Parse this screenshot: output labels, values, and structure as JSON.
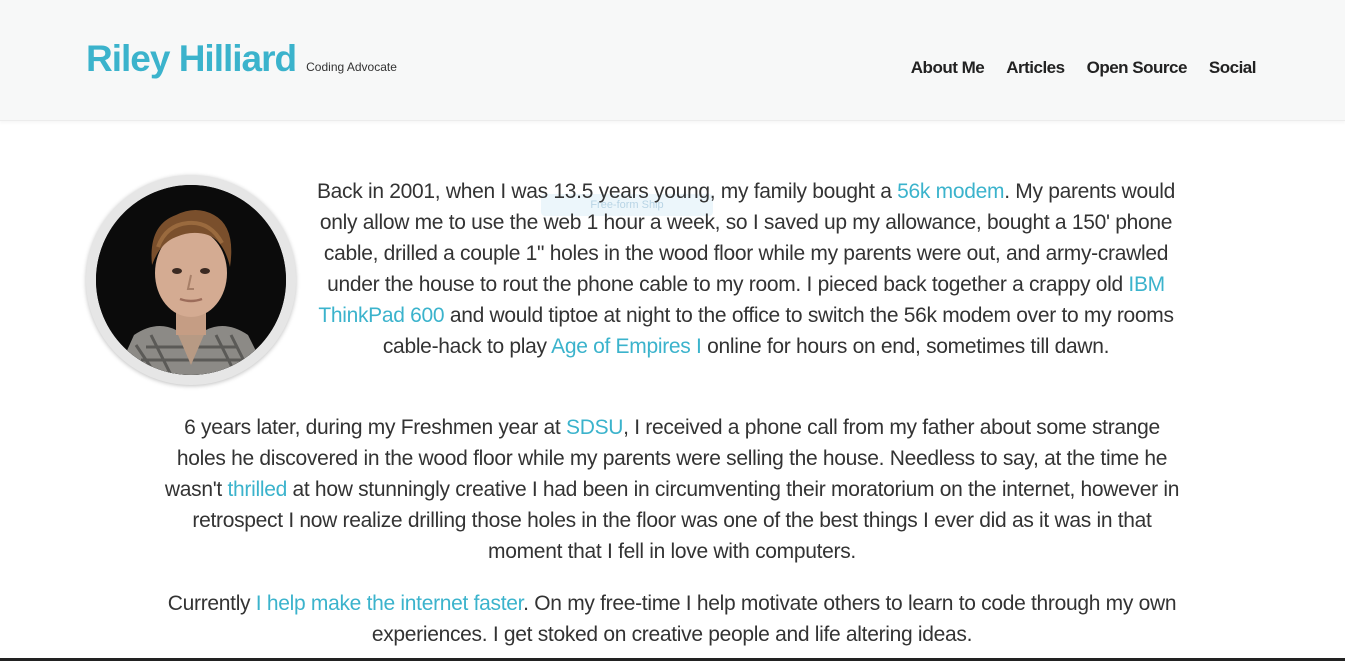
{
  "header": {
    "name": "Riley Hilliard",
    "tagline": "Coding Advocate",
    "nav": [
      "About Me",
      "Articles",
      "Open Source",
      "Social"
    ]
  },
  "overlay": {
    "ghost_text": "Free-form Ship"
  },
  "bio": {
    "p1": {
      "t1": "Back in 2001, when I was 13.5 years young, my family bought a ",
      "link1": "56k modem",
      "t2": ". My parents would only allow me to use the web 1 hour a week, so I saved up my allowance, bought a 150' phone cable, drilled a couple 1\" holes in the wood floor while my parents were out, and army-crawled under the house to rout the phone cable to my room. I pieced back together a crappy old ",
      "link2": "IBM ThinkPad 600",
      "t3": " and would tiptoe at night to the office to switch the 56k modem over to my rooms cable-hack to play ",
      "link3": "Age of Empires I",
      "t4": " online for hours on end, sometimes till dawn."
    },
    "p2": {
      "t1": "6 years later, during my Freshmen year at ",
      "link1": "SDSU",
      "t2": ", I received a phone call from my father about some strange holes he discovered in the wood floor while my parents were selling the house. Needless to say, at the time he wasn't ",
      "link2": "thrilled",
      "t3": " at how stunningly creative I had been in circumventing their moratorium on the internet, however in retrospect I now realize drilling those holes in the floor was one of the best things I ever did as it was in that moment that I fell in love with computers."
    },
    "p3": {
      "t1": "Currently ",
      "link1": "I help make the internet faster",
      "t2": ". On my free-time I help motivate others to learn to code through my own experiences. I get stoked on creative people and life altering ideas."
    }
  },
  "colors": {
    "accent": "#3bb3cc",
    "header_bg": "#f7f8f8",
    "text": "#333333"
  }
}
